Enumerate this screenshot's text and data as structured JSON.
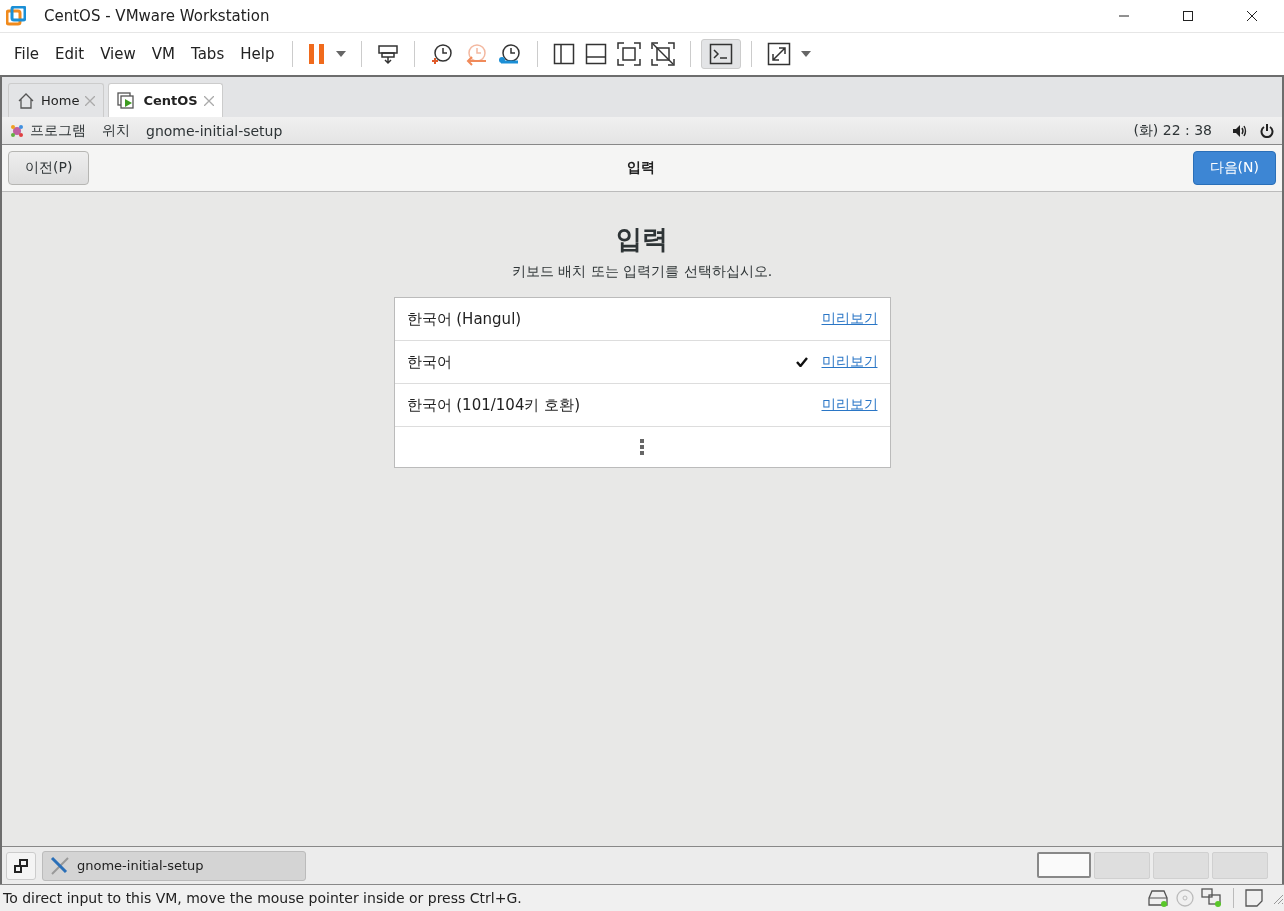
{
  "window": {
    "title": "CentOS - VMware Workstation"
  },
  "menu": [
    "File",
    "Edit",
    "View",
    "VM",
    "Tabs",
    "Help"
  ],
  "tabs": [
    {
      "label": "Home",
      "selected": false
    },
    {
      "label": "CentOS",
      "selected": true
    }
  ],
  "gnome_panel": {
    "menus": [
      "프로그램",
      "위치",
      "gnome-initial-setup"
    ],
    "clock": "(화) 22 : 38"
  },
  "header": {
    "back": "이전(P)",
    "title": "입력",
    "next": "다음(N)"
  },
  "page": {
    "heading": "입력",
    "subtitle": "키보드 배치 또는 입력기를 선택하십시오."
  },
  "layouts": [
    {
      "name": "한국어 (Hangul)",
      "selected": false,
      "preview": "미리보기"
    },
    {
      "name": "한국어",
      "selected": true,
      "preview": "미리보기"
    },
    {
      "name": "한국어 (101/104키 호환)",
      "selected": false,
      "preview": "미리보기"
    }
  ],
  "taskbar": {
    "window": "gnome-initial-setup",
    "workspaces": [
      {
        "selected": true
      },
      {
        "selected": false
      },
      {
        "selected": false
      },
      {
        "selected": false
      }
    ]
  },
  "status_bar": "To direct input to this VM, move the mouse pointer inside or press Ctrl+G."
}
